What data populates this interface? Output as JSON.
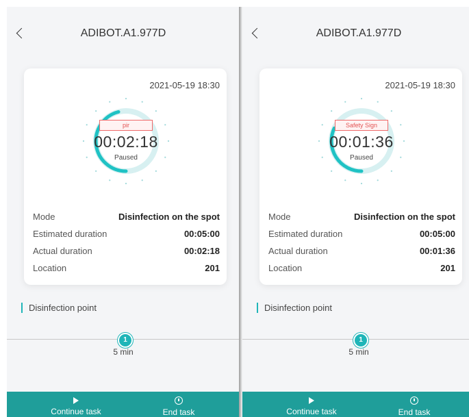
{
  "colors": {
    "accent": "#1fb5b8",
    "action_bar": "#1f9e9a",
    "alert_red": "#e25353"
  },
  "panels": [
    {
      "header": {
        "title": "ADIBOT.A1.977D",
        "back_icon": "chevron-left-icon"
      },
      "card": {
        "timestamp": "2021-05-19 18:30",
        "reason_badge": "pir",
        "elapsed": "00:02:18",
        "state": "Paused",
        "progress": 0.46,
        "rows": [
          {
            "label": "Mode",
            "value": "Disinfection on the spot"
          },
          {
            "label": "Estimated duration",
            "value": "00:05:00"
          },
          {
            "label": "Actual duration",
            "value": "00:02:18"
          },
          {
            "label": "Location",
            "value": "201"
          }
        ]
      },
      "section_title": "Disinfection point",
      "point": {
        "number": "1",
        "duration": "5 min"
      },
      "actions": {
        "continue_label": "Continue task",
        "continue_icon": "play-icon",
        "end_label": "End task",
        "end_icon": "stop-icon"
      }
    },
    {
      "header": {
        "title": "ADIBOT.A1.977D",
        "back_icon": "chevron-left-icon"
      },
      "card": {
        "timestamp": "2021-05-19 18:30",
        "reason_badge": "Safety Sign",
        "elapsed": "00:01:36",
        "state": "Paused",
        "progress": 0.32,
        "rows": [
          {
            "label": "Mode",
            "value": "Disinfection on the spot"
          },
          {
            "label": "Estimated duration",
            "value": "00:05:00"
          },
          {
            "label": "Actual duration",
            "value": "00:01:36"
          },
          {
            "label": "Location",
            "value": "201"
          }
        ]
      },
      "section_title": "Disinfection point",
      "point": {
        "number": "1",
        "duration": "5 min"
      },
      "actions": {
        "continue_label": "Continue task",
        "continue_icon": "play-icon",
        "end_label": "End task",
        "end_icon": "stop-icon"
      }
    }
  ]
}
